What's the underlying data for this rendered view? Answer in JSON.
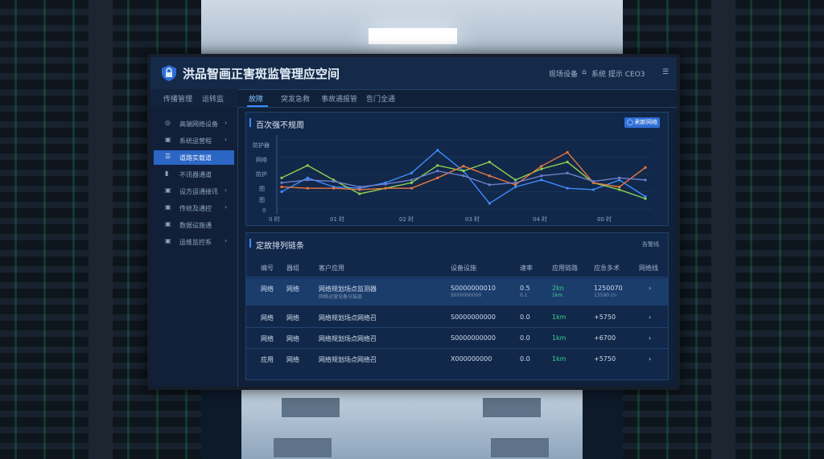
{
  "window": {
    "title": "洪品智画正害斑监管理应空间",
    "status_items": [
      "现场设备",
      "系统 提示 CEO3"
    ]
  },
  "nav": {
    "left_tabs": [
      "传播管理",
      "运转监"
    ],
    "tabs": [
      {
        "label": "故障",
        "active": true
      },
      {
        "label": "突发急救"
      },
      {
        "label": "事故通报管"
      },
      {
        "label": "告门全通"
      }
    ]
  },
  "sidebar": {
    "items": [
      {
        "label": "高端网络设备",
        "icon": "eye-icon",
        "active": false,
        "chevron": "›"
      },
      {
        "label": "系统运营程",
        "icon": "lock-icon",
        "active": false,
        "chevron": "›"
      },
      {
        "label": "道路实载道",
        "icon": "list-icon",
        "active": true,
        "chevron": ""
      },
      {
        "label": "不讯器通道",
        "icon": "pin-icon",
        "active": false,
        "chevron": ""
      },
      {
        "label": "设方运通接讯",
        "icon": "lock-icon",
        "active": false,
        "chevron": "›"
      },
      {
        "label": "传统及通控",
        "icon": "lock-icon",
        "active": false,
        "chevron": "›"
      },
      {
        "label": "数据设施通",
        "icon": "lock-icon",
        "active": false,
        "chevron": ""
      },
      {
        "label": "运维监控系",
        "icon": "lock-icon",
        "active": false,
        "chevron": "›"
      }
    ]
  },
  "chart_panel": {
    "title": "百次强不规周",
    "refresh_label": "◯ 刷新网络"
  },
  "chart_data": {
    "type": "line",
    "title": "百次强不规周",
    "x": [
      0,
      1,
      2,
      3,
      4,
      5,
      6,
      7,
      8,
      9,
      10,
      11,
      12,
      13,
      14
    ],
    "xticks": [
      "0 时",
      "01 时",
      "02 时",
      "03 时",
      "04 时",
      "00 时"
    ],
    "yticks": [
      "防护器",
      "网络",
      "防护",
      "图",
      "图",
      "0"
    ],
    "ylim": [
      0,
      100
    ],
    "series": [
      {
        "color": "#3d8dff",
        "values": [
          25,
          45,
          32,
          30,
          38,
          52,
          85,
          55,
          8,
          32,
          42,
          30,
          28,
          42,
          18
        ]
      },
      {
        "color": "#8fd14f",
        "values": [
          45,
          63,
          42,
          22,
          30,
          38,
          63,
          55,
          68,
          42,
          58,
          68,
          38,
          28,
          15
        ]
      },
      {
        "color": "#e8763e",
        "values": [
          32,
          30,
          30,
          28,
          30,
          30,
          45,
          62,
          48,
          35,
          62,
          82,
          38,
          32,
          60
        ]
      },
      {
        "color": "#6b7ec9",
        "values": [
          38,
          42,
          40,
          32,
          36,
          42,
          55,
          48,
          35,
          38,
          48,
          52,
          40,
          45,
          42
        ]
      }
    ]
  },
  "table_panel": {
    "title": "定故排列链条",
    "right_link": "告警线",
    "headers": [
      "编号",
      "器组",
      "客户应用",
      "设备设施",
      "速率",
      "应用链路",
      "应急多术",
      "网络线"
    ],
    "rows": [
      {
        "id": "网络",
        "group": "网络",
        "app": "网络规划场点监测器",
        "device": "S0000000010",
        "rate": "0.5",
        "link": "2kn",
        "multi": "1250070",
        "selected": true,
        "sub_app": "网络运营设备分装层",
        "sub_device": "S000000000",
        "sub_rate": "0.1",
        "sub_link": "1km",
        "sub_multi": "13590 cn"
      },
      {
        "id": "网络",
        "group": "网络",
        "app": "网络规划场点网络召",
        "device": "S0000000000",
        "rate": "0.0",
        "link": "1km",
        "multi": "+5750",
        "selected": false
      },
      {
        "id": "网络",
        "group": "网络",
        "app": "网络规划场点网络召",
        "device": "S0000000000",
        "rate": "0.0",
        "link": "1km",
        "multi": "+6700",
        "selected": false
      },
      {
        "id": "应用",
        "group": "网络",
        "app": "网络规划场点网络召",
        "device": "X000000000",
        "rate": "0.0",
        "link": "1km",
        "multi": "+5750",
        "selected": false
      }
    ]
  }
}
